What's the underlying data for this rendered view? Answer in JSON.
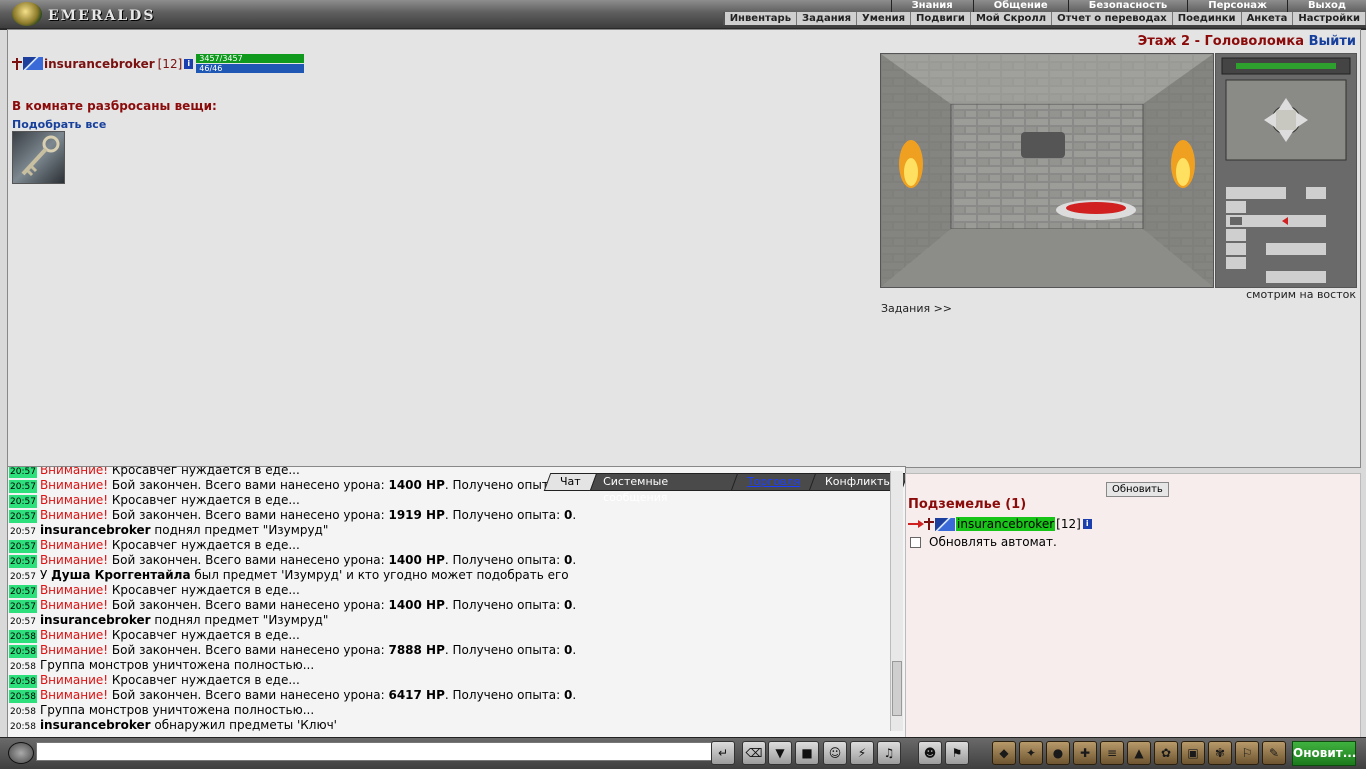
{
  "header": {
    "logo_text": "EMERALDS",
    "main_menu": [
      "Знания",
      "Общение",
      "Безопасность",
      "Персонаж",
      "Выход"
    ],
    "sub_menu": [
      "Инвентарь",
      "Задания",
      "Умения",
      "Подвиги",
      "Мой Скролл",
      "Отчет о переводах",
      "Поединки",
      "Анкета",
      "Настройки"
    ]
  },
  "player": {
    "name": "insurancebroker",
    "level": "[12]",
    "hp": "3457/3457",
    "mp": "46/46",
    "hp_fraction": 1.0,
    "mp_fraction": 1.0
  },
  "room": {
    "items_title": "В комнате разбросаны вещи:",
    "pickup_all": "Подобрать все",
    "floor_title": "Этаж 2 - Головоломка",
    "exit_label": "Выйти",
    "facing": "смотрим на восток",
    "tasks_link": "Задания >>"
  },
  "chat": {
    "tabs": [
      "Чат",
      "Системные сообщения",
      "Торговля",
      "Конфликты"
    ],
    "lines": [
      {
        "time": "20:57",
        "hl": true,
        "parts": [
          {
            "t": "Внимание!",
            "c": "warn"
          },
          {
            "t": " Кросавчег нуждается в еде..."
          }
        ]
      },
      {
        "time": "20:57",
        "hl": true,
        "parts": [
          {
            "t": "Внимание!",
            "c": "warn"
          },
          {
            "t": " Бой закончен. Всего вами нанесено урона: "
          },
          {
            "t": "1400 HP",
            "c": "who"
          },
          {
            "t": ". Получено опыта: "
          },
          {
            "t": "0",
            "c": "who"
          },
          {
            "t": "."
          }
        ]
      },
      {
        "time": "20:57",
        "hl": true,
        "parts": [
          {
            "t": "Внимание!",
            "c": "warn"
          },
          {
            "t": " Кросавчег нуждается в еде..."
          }
        ]
      },
      {
        "time": "20:57",
        "hl": true,
        "parts": [
          {
            "t": "Внимание!",
            "c": "warn"
          },
          {
            "t": " Бой закончен. Всего вами нанесено урона: "
          },
          {
            "t": "1919 HP",
            "c": "who"
          },
          {
            "t": ". Получено опыта: "
          },
          {
            "t": "0",
            "c": "who"
          },
          {
            "t": "."
          }
        ]
      },
      {
        "time": "20:57",
        "hl": false,
        "parts": [
          {
            "t": "insurancebroker",
            "c": "who"
          },
          {
            "t": " поднял предмет \"Изумруд\""
          }
        ]
      },
      {
        "time": "20:57",
        "hl": true,
        "parts": [
          {
            "t": "Внимание!",
            "c": "warn"
          },
          {
            "t": " Кросавчег нуждается в еде..."
          }
        ]
      },
      {
        "time": "20:57",
        "hl": true,
        "parts": [
          {
            "t": "Внимание!",
            "c": "warn"
          },
          {
            "t": " Бой закончен. Всего вами нанесено урона: "
          },
          {
            "t": "1400 HP",
            "c": "who"
          },
          {
            "t": ". Получено опыта: "
          },
          {
            "t": "0",
            "c": "who"
          },
          {
            "t": "."
          }
        ]
      },
      {
        "time": "20:57",
        "hl": false,
        "parts": [
          {
            "t": "У "
          },
          {
            "t": "Душа Кроггентайла",
            "c": "who"
          },
          {
            "t": " был предмет 'Изумруд' и кто угодно может подобрать его"
          }
        ]
      },
      {
        "time": "20:57",
        "hl": true,
        "parts": [
          {
            "t": "Внимание!",
            "c": "warn"
          },
          {
            "t": " Кросавчег нуждается в еде..."
          }
        ]
      },
      {
        "time": "20:57",
        "hl": true,
        "parts": [
          {
            "t": "Внимание!",
            "c": "warn"
          },
          {
            "t": " Бой закончен. Всего вами нанесено урона: "
          },
          {
            "t": "1400 HP",
            "c": "who"
          },
          {
            "t": ". Получено опыта: "
          },
          {
            "t": "0",
            "c": "who"
          },
          {
            "t": "."
          }
        ]
      },
      {
        "time": "20:57",
        "hl": false,
        "parts": [
          {
            "t": "insurancebroker",
            "c": "who"
          },
          {
            "t": " поднял предмет \"Изумруд\""
          }
        ]
      },
      {
        "time": "20:58",
        "hl": true,
        "parts": [
          {
            "t": "Внимание!",
            "c": "warn"
          },
          {
            "t": " Кросавчег нуждается в еде..."
          }
        ]
      },
      {
        "time": "20:58",
        "hl": true,
        "parts": [
          {
            "t": "Внимание!",
            "c": "warn"
          },
          {
            "t": " Бой закончен. Всего вами нанесено урона: "
          },
          {
            "t": "7888 HP",
            "c": "who"
          },
          {
            "t": ". Получено опыта: "
          },
          {
            "t": "0",
            "c": "who"
          },
          {
            "t": "."
          }
        ]
      },
      {
        "time": "20:58",
        "hl": false,
        "parts": [
          {
            "t": "Группа монстров уничтожена полностью..."
          }
        ]
      },
      {
        "time": "20:58",
        "hl": true,
        "parts": [
          {
            "t": "Внимание!",
            "c": "warn"
          },
          {
            "t": " Кросавчег нуждается в еде..."
          }
        ]
      },
      {
        "time": "20:58",
        "hl": true,
        "parts": [
          {
            "t": "Внимание!",
            "c": "warn"
          },
          {
            "t": " Бой закончен. Всего вами нанесено урона: "
          },
          {
            "t": "6417 HP",
            "c": "who"
          },
          {
            "t": ". Получено опыта: "
          },
          {
            "t": "0",
            "c": "who"
          },
          {
            "t": "."
          }
        ]
      },
      {
        "time": "20:58",
        "hl": false,
        "parts": [
          {
            "t": "Группа монстров уничтожена полностью..."
          }
        ]
      },
      {
        "time": "20:58",
        "hl": false,
        "parts": [
          {
            "t": "insurancebroker",
            "c": "who"
          },
          {
            "t": " обнаружил предметы 'Ключ'"
          }
        ]
      }
    ]
  },
  "dungeon_panel": {
    "refresh_label": "Обновить",
    "title": "Подземелье (1)",
    "player_name": "insurancebroker",
    "player_level": "[12]",
    "auto_refresh_label": "Обновлять автомат."
  },
  "bottom": {
    "refresh_label": "Оновит..."
  },
  "colors": {
    "dark_red": "#8b0b0b",
    "link_blue": "#173f9c",
    "timestamp_green": "#2de07c",
    "hp_green": "#0f9a1e",
    "mp_blue": "#1f57b5"
  }
}
